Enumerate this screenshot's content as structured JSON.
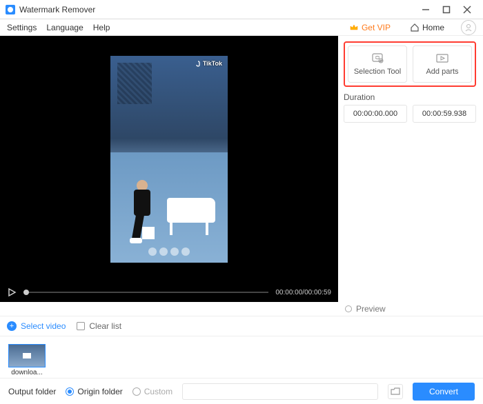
{
  "titlebar": {
    "app_name": "Watermark Remover"
  },
  "menu": {
    "settings": "Settings",
    "language": "Language",
    "help": "Help",
    "get_vip": "Get VIP",
    "home": "Home"
  },
  "video": {
    "watermark": "TikTok"
  },
  "tools": {
    "selection": "Selection Tool",
    "add_parts": "Add parts"
  },
  "duration": {
    "label": "Duration",
    "start": "00:00:00.000",
    "end": "00:00:59.938"
  },
  "playbar": {
    "time": "00:00:00/00:00:59"
  },
  "preview": {
    "label": "Preview"
  },
  "list": {
    "select_video": "Select video",
    "clear": "Clear list"
  },
  "thumb": {
    "name": "downloa..."
  },
  "output": {
    "label": "Output folder",
    "origin": "Origin folder",
    "custom": "Custom",
    "convert": "Convert"
  }
}
